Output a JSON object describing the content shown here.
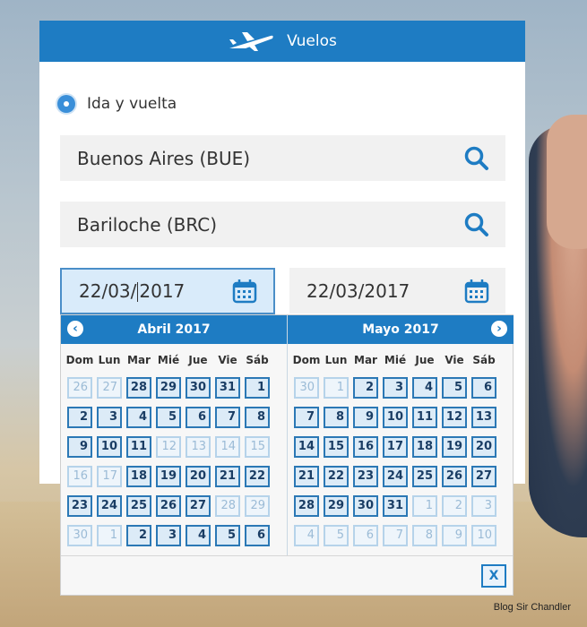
{
  "widget": {
    "title": "Vuelos"
  },
  "trip_type": {
    "label": "Ida y vuelta",
    "selected": true
  },
  "origin": {
    "value": "Buenos Aires (BUE)"
  },
  "destination": {
    "value": "Bariloche (BRC)"
  },
  "dates": {
    "departure": {
      "before_caret": "22/03/",
      "after_caret": "2017"
    },
    "return": {
      "value": "22/03/2017"
    }
  },
  "calendar": {
    "weekdays": [
      "Dom",
      "Lun",
      "Mar",
      "Mié",
      "Jue",
      "Vie",
      "Sáb"
    ],
    "months": [
      {
        "title": "Abril 2017",
        "days": [
          {
            "d": "26",
            "on": false
          },
          {
            "d": "27",
            "on": false
          },
          {
            "d": "28",
            "on": true
          },
          {
            "d": "29",
            "on": true
          },
          {
            "d": "30",
            "on": true
          },
          {
            "d": "31",
            "on": true
          },
          {
            "d": "1",
            "on": true
          },
          {
            "d": "2",
            "on": true
          },
          {
            "d": "3",
            "on": true
          },
          {
            "d": "4",
            "on": true
          },
          {
            "d": "5",
            "on": true
          },
          {
            "d": "6",
            "on": true
          },
          {
            "d": "7",
            "on": true
          },
          {
            "d": "8",
            "on": true
          },
          {
            "d": "9",
            "on": true
          },
          {
            "d": "10",
            "on": true
          },
          {
            "d": "11",
            "on": true
          },
          {
            "d": "12",
            "on": false
          },
          {
            "d": "13",
            "on": false
          },
          {
            "d": "14",
            "on": false
          },
          {
            "d": "15",
            "on": false
          },
          {
            "d": "16",
            "on": false
          },
          {
            "d": "17",
            "on": false
          },
          {
            "d": "18",
            "on": true
          },
          {
            "d": "19",
            "on": true
          },
          {
            "d": "20",
            "on": true
          },
          {
            "d": "21",
            "on": true
          },
          {
            "d": "22",
            "on": true
          },
          {
            "d": "23",
            "on": true
          },
          {
            "d": "24",
            "on": true
          },
          {
            "d": "25",
            "on": true
          },
          {
            "d": "26",
            "on": true
          },
          {
            "d": "27",
            "on": true
          },
          {
            "d": "28",
            "on": false
          },
          {
            "d": "29",
            "on": false
          },
          {
            "d": "30",
            "on": false
          },
          {
            "d": "1",
            "on": false
          },
          {
            "d": "2",
            "on": true
          },
          {
            "d": "3",
            "on": true
          },
          {
            "d": "4",
            "on": true
          },
          {
            "d": "5",
            "on": true
          },
          {
            "d": "6",
            "on": true
          }
        ]
      },
      {
        "title": "Mayo 2017",
        "days": [
          {
            "d": "30",
            "on": false
          },
          {
            "d": "1",
            "on": false
          },
          {
            "d": "2",
            "on": true
          },
          {
            "d": "3",
            "on": true
          },
          {
            "d": "4",
            "on": true
          },
          {
            "d": "5",
            "on": true
          },
          {
            "d": "6",
            "on": true
          },
          {
            "d": "7",
            "on": true
          },
          {
            "d": "8",
            "on": true
          },
          {
            "d": "9",
            "on": true
          },
          {
            "d": "10",
            "on": true
          },
          {
            "d": "11",
            "on": true
          },
          {
            "d": "12",
            "on": true
          },
          {
            "d": "13",
            "on": true
          },
          {
            "d": "14",
            "on": true
          },
          {
            "d": "15",
            "on": true
          },
          {
            "d": "16",
            "on": true
          },
          {
            "d": "17",
            "on": true
          },
          {
            "d": "18",
            "on": true
          },
          {
            "d": "19",
            "on": true
          },
          {
            "d": "20",
            "on": true
          },
          {
            "d": "21",
            "on": true
          },
          {
            "d": "22",
            "on": true
          },
          {
            "d": "23",
            "on": true
          },
          {
            "d": "24",
            "on": true
          },
          {
            "d": "25",
            "on": true
          },
          {
            "d": "26",
            "on": true
          },
          {
            "d": "27",
            "on": true
          },
          {
            "d": "28",
            "on": true
          },
          {
            "d": "29",
            "on": true
          },
          {
            "d": "30",
            "on": true
          },
          {
            "d": "31",
            "on": true
          },
          {
            "d": "1",
            "on": false
          },
          {
            "d": "2",
            "on": false
          },
          {
            "d": "3",
            "on": false
          },
          {
            "d": "4",
            "on": false
          },
          {
            "d": "5",
            "on": false
          },
          {
            "d": "6",
            "on": false
          },
          {
            "d": "7",
            "on": false
          },
          {
            "d": "8",
            "on": false
          },
          {
            "d": "9",
            "on": false
          },
          {
            "d": "10",
            "on": false
          }
        ]
      }
    ],
    "prev_label": "‹",
    "next_label": "›",
    "close_label": "X"
  },
  "credit": "Blog Sir Chandler",
  "colors": {
    "accent": "#1e7cc3",
    "field_bg": "#f1f1f1",
    "active_field": "#d9ebfa"
  },
  "icons": {
    "header": "airplane-icon",
    "search": "search-icon",
    "date": "calendar-icon"
  }
}
